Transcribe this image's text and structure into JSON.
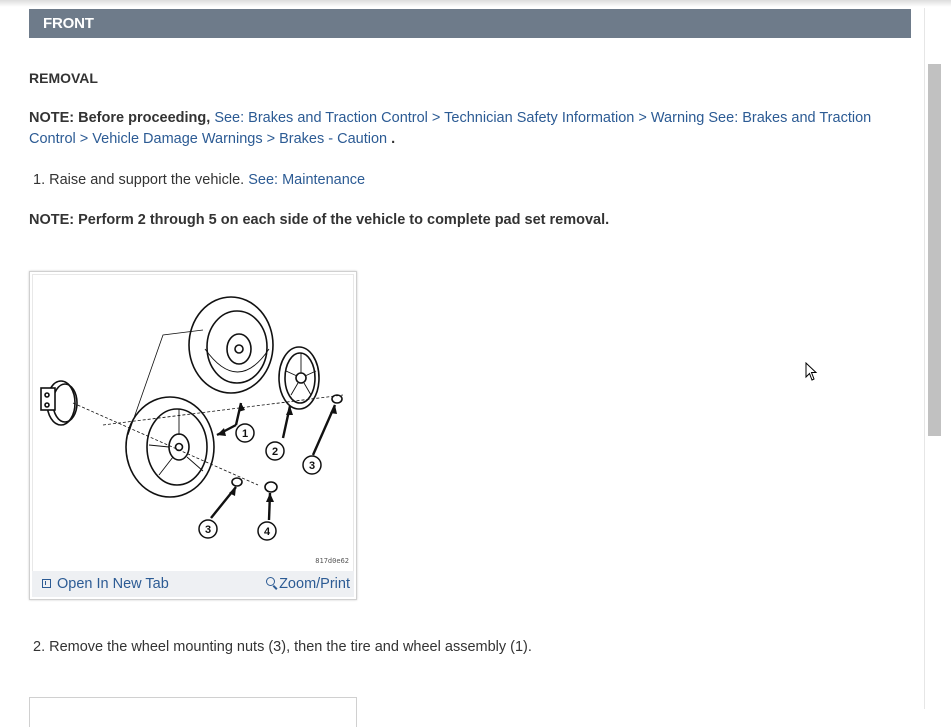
{
  "section": {
    "title": "FRONT"
  },
  "removal": {
    "heading": "REMOVAL",
    "note1": {
      "label": "NOTE:  Before proceeding,",
      "link1": "See: Brakes and Traction Control > Technician Safety Information > Warning",
      "link2": "See: Brakes and Traction Control > Vehicle Damage Warnings > Brakes - Caution",
      "end": "."
    },
    "step1": {
      "text": "1. Raise and support the vehicle.",
      "link": "See: Maintenance"
    },
    "note2": "NOTE:  Perform 2 through 5 on each side of the vehicle to complete pad set removal.",
    "figure": {
      "code": "817d0e62",
      "callouts": [
        "1",
        "2",
        "3",
        "3",
        "4"
      ],
      "open_tab_label": "Open In New Tab",
      "zoom_label": "Zoom/Print",
      "open_icon": "open-new-tab-icon",
      "zoom_icon": "zoom-magnifier-icon"
    },
    "step2": {
      "text": "2. Remove the wheel mounting nuts (3), then the tire and wheel assembly (1)."
    }
  },
  "colors": {
    "section_bar": "#6e7b8a",
    "link": "#2c5b94",
    "text": "#333333"
  }
}
